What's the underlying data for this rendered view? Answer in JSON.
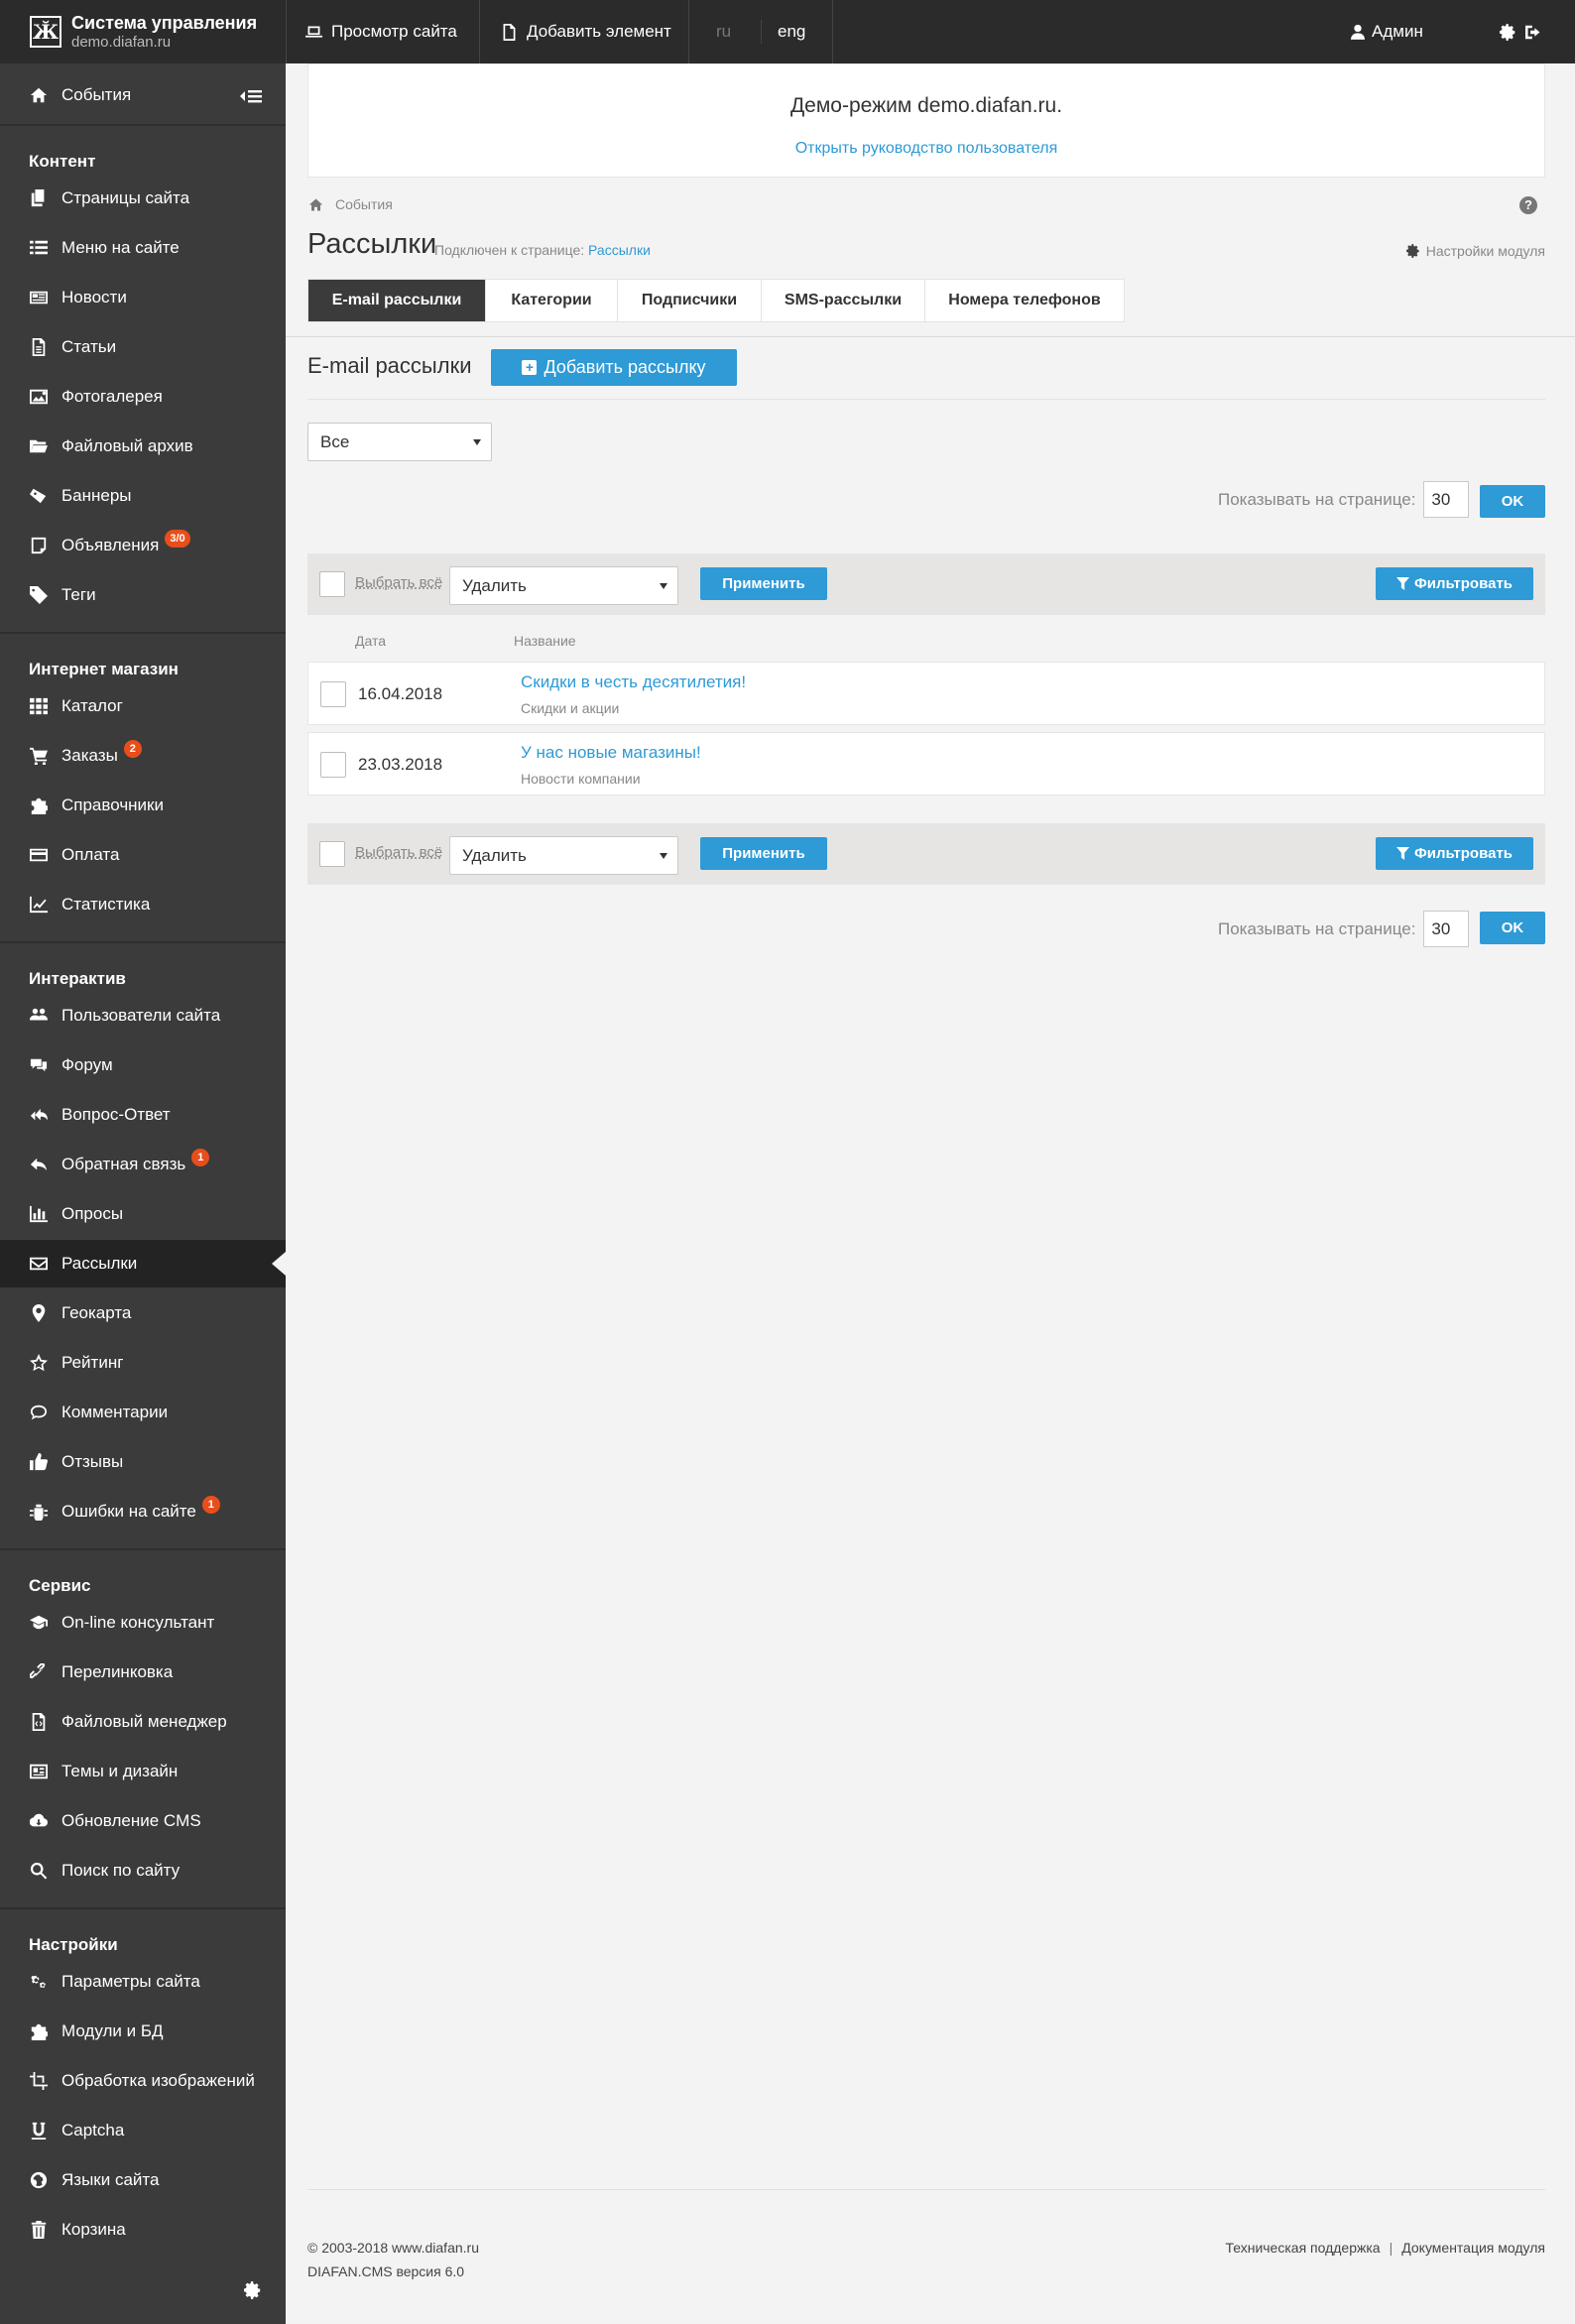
{
  "brand": {
    "title": "Система управления",
    "subtitle": "demo.diafan.ru"
  },
  "topbar": {
    "view_site": "Просмотр сайта",
    "add_element": "Добавить элемент",
    "lang_ru": "ru",
    "lang_eng": "eng",
    "user": "Админ"
  },
  "sidebar": {
    "events": "События",
    "sections": [
      {
        "title": "Контент",
        "items": [
          {
            "label": "Страницы сайта",
            "icon": "pages-icon"
          },
          {
            "label": "Меню на сайте",
            "icon": "menu-list-icon"
          },
          {
            "label": "Новости",
            "icon": "news-icon"
          },
          {
            "label": "Статьи",
            "icon": "article-icon"
          },
          {
            "label": "Фотогалерея",
            "icon": "image-icon"
          },
          {
            "label": "Файловый архив",
            "icon": "folder-icon"
          },
          {
            "label": "Баннеры",
            "icon": "banner-icon"
          },
          {
            "label": "Объявления",
            "icon": "ad-icon",
            "badge": "3/0"
          },
          {
            "label": "Теги",
            "icon": "tag-icon"
          }
        ]
      },
      {
        "title": "Интернет магазин",
        "items": [
          {
            "label": "Каталог",
            "icon": "grid-icon"
          },
          {
            "label": "Заказы",
            "icon": "cart-icon",
            "badge": "2"
          },
          {
            "label": "Справочники",
            "icon": "puzzle-icon"
          },
          {
            "label": "Оплата",
            "icon": "card-icon"
          },
          {
            "label": "Статистика",
            "icon": "chart-icon"
          }
        ]
      },
      {
        "title": "Интерактив",
        "items": [
          {
            "label": "Пользователи сайта",
            "icon": "users-icon"
          },
          {
            "label": "Форум",
            "icon": "comments-icon"
          },
          {
            "label": "Вопрос-Ответ",
            "icon": "reply-all-icon"
          },
          {
            "label": "Обратная связь",
            "icon": "reply-icon",
            "badge": "1"
          },
          {
            "label": "Опросы",
            "icon": "bar-chart-icon"
          },
          {
            "label": "Рассылки",
            "icon": "envelope-icon",
            "active": true
          },
          {
            "label": "Геокарта",
            "icon": "map-marker-icon"
          },
          {
            "label": "Рейтинг",
            "icon": "star-icon"
          },
          {
            "label": "Комментарии",
            "icon": "comment-icon"
          },
          {
            "label": "Отзывы",
            "icon": "thumbs-up-icon"
          },
          {
            "label": "Ошибки на сайте",
            "icon": "bug-icon",
            "badge": "1"
          }
        ]
      },
      {
        "title": "Сервис",
        "items": [
          {
            "label": "On-line консультант",
            "icon": "graduation-cap-icon"
          },
          {
            "label": "Перелинковка",
            "icon": "link-icon"
          },
          {
            "label": "Файловый менеджер",
            "icon": "file-code-icon"
          },
          {
            "label": "Темы и дизайн",
            "icon": "theme-icon"
          },
          {
            "label": "Обновление CMS",
            "icon": "cloud-download-icon"
          },
          {
            "label": "Поиск по сайту",
            "icon": "search-icon"
          }
        ]
      },
      {
        "title": "Настройки",
        "items": [
          {
            "label": "Параметры сайта",
            "icon": "gears-icon"
          },
          {
            "label": "Модули и БД",
            "icon": "puzzle-icon"
          },
          {
            "label": "Обработка изображений",
            "icon": "crop-icon"
          },
          {
            "label": "Captcha",
            "icon": "underline-icon"
          },
          {
            "label": "Языки сайта",
            "icon": "globe-icon"
          },
          {
            "label": "Корзина",
            "icon": "trash-icon"
          }
        ]
      }
    ]
  },
  "demo": {
    "title": "Демо-режим demo.diafan.ru.",
    "link": "Открыть руководство пользователя"
  },
  "breadcrumb": {
    "item": "События"
  },
  "header": {
    "title": "Рассылки",
    "connected_prefix": "Подключен к странице:",
    "connected_page": "Рассылки",
    "module_settings": "Настройки модуля"
  },
  "tabs": [
    "E-mail рассылки",
    "Категории",
    "Подписчики",
    "SMS-рассылки",
    "Номера телефонов"
  ],
  "section": {
    "title": "E-mail рассылки",
    "add_button": "Добавить рассылку"
  },
  "filter": {
    "selected": "Все"
  },
  "perpage": {
    "label": "Показывать на странице:",
    "value": "30",
    "ok": "OK"
  },
  "bulk": {
    "select_all": "Выбрать всё",
    "action": "Удалить",
    "apply": "Применить",
    "filter": "Фильтровать"
  },
  "table": {
    "columns": [
      "Дата",
      "Название"
    ],
    "rows": [
      {
        "date": "16.04.2018",
        "title": "Скидки в честь десятилетия!",
        "category": "Скидки и акции"
      },
      {
        "date": "23.03.2018",
        "title": "У нас новые магазины!",
        "category": "Новости компании"
      }
    ]
  },
  "footer": {
    "copyright": "© 2003-2018 www.diafan.ru",
    "version": "DIAFAN.CMS версия 6.0",
    "support": "Техническая поддержка",
    "sep": "|",
    "docs": "Документация модуля"
  }
}
